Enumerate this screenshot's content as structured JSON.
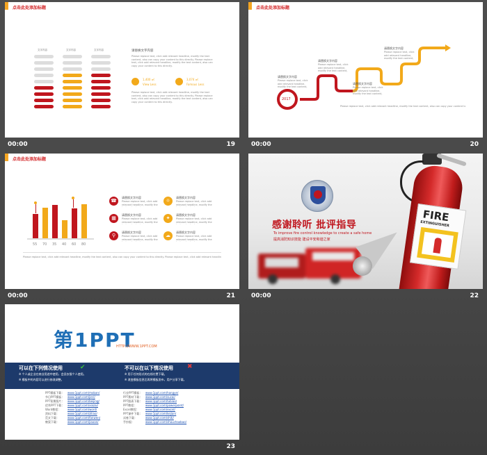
{
  "slides": [
    {
      "number": "19",
      "time": "00:00",
      "title": "点击此处添加标题",
      "col_labels": [
        "文字内容",
        "文字内容",
        "文字内容"
      ],
      "text_heading": "请替换文字内容",
      "body": "Please replace text, click add relevant headline, modify the text content, also can copy your content to this directly. Please replace text, click add relevant headline, modify the text content, also can copy your content to this directly.",
      "stat1_value": "1,400 ㎡",
      "stat1_label": "View Less",
      "stat2_value": "3,074 ㎡",
      "stat2_label": "Famous Less",
      "body2": "Please replace text, click add relevant headline, modify the text content, also can copy your content to this directly. Please replace text, click add relevant headline, modify the text content, also can copy your content to this directly."
    },
    {
      "number": "20",
      "time": "00:00",
      "title": "点击此处添加标题",
      "year": "2017",
      "labels": [
        "请替换文字内容",
        "请替换文字内容",
        "请替换文字内容",
        "请替换文字内容"
      ],
      "body": "Please replace text, click add relevant headline, modify the text content, also can copy your content to this directly.",
      "footer_note": "Please replace text, click add relevant headline, modify the text content, also can copy your content to this directly."
    },
    {
      "number": "21",
      "time": "00:00",
      "title": "点击此处添加标题",
      "bar_labels": [
        "55",
        "70",
        "35",
        "40",
        "60",
        "80"
      ],
      "item_heading": "请替换文字内容",
      "item_body": "Please replace text, click add relevant headline, modify the text content, also can copy your content to this directly.",
      "footer_note": "Please replace text, click add relevant headline, modify the text content, also can copy your content to this directly. Please replace text, click add relevant headline, modify the text content, also can copy your content to this directly."
    },
    {
      "number": "22",
      "time": "00:00",
      "heading": "感谢聆听 批评指导",
      "subheading": "To improve fire control knowledge to create a safe home",
      "subheading_cn": "提高消防知识技能 建设平安和谐之家",
      "extinguisher_word1": "FIRE",
      "extinguisher_word2": "EXTINGUISHER"
    },
    {
      "number": "23",
      "logo_main": "第1PPT",
      "logo_url": "HTTP://WWW.1PPT.COM",
      "left_heading": "可以在下列情况使用",
      "right_heading": "不可以在以下情况使用",
      "left_points": [
        "※ 个人或企业在商业用途中使用，会员仅限个人使用。",
        "※ 模板中的内容可以进行修改调整。"
      ],
      "right_points": [
        "※ 用于任何形式的在线付费下载。",
        "※ 改变模板信息后再将模板发布，用户分享下载。"
      ],
      "link_rows": [
        [
          "PPT模板下载：",
          "www.1ppt.com/moban/",
          "行业PPT模板：",
          "www.1ppt.com/hangye/"
        ],
        [
          "节日PPT模板：",
          "www.1ppt.com/jieri/",
          "PPT素材下载：",
          "www.1ppt.com/sucai/"
        ],
        [
          "PPT背景图片：",
          "www.1ppt.com/beijing/",
          "PPT图表下载：",
          "www.1ppt.com/tubiao/"
        ],
        [
          "优秀PPT下载：",
          "www.1ppt.com/xiazai/",
          "PPT教程：",
          "www.1ppt.com/powerpoint/"
        ],
        [
          "Word教程：",
          "www.1ppt.com/word/",
          "Excel教程：",
          "www.1ppt.com/excel/"
        ],
        [
          "资料下载：",
          "www.1ppt.com/ziliao/",
          "PPT课件下载：",
          "www.1ppt.com/kejian/"
        ],
        [
          "范文下载：",
          "www.1ppt.com/fanwen/",
          "试卷下载：",
          "www.1ppt.com/shiti/"
        ],
        [
          "教案下载：",
          "www.1ppt.com/jiaoan/",
          "手抄报：",
          "www.1ppt.com/shouchaobao/"
        ]
      ]
    }
  ]
}
